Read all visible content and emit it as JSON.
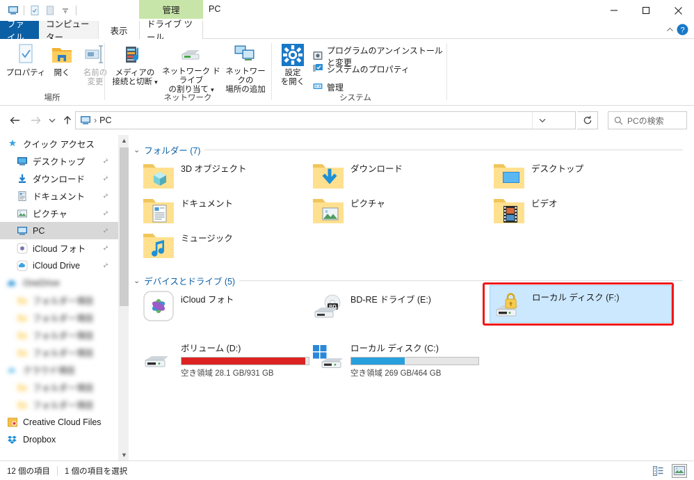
{
  "titlebar": {
    "quick_access": [
      "this-pc-icon",
      "properties-icon",
      "new-folder-icon",
      "customize-dropdown-icon"
    ],
    "contextual_tab_header": "管理",
    "window_title": "PC",
    "minimize": "minimize-icon",
    "maximize": "maximize-icon",
    "close": "close-icon"
  },
  "tabs": [
    {
      "label": "ファイル",
      "active": false
    },
    {
      "label": "コンピューター",
      "active": false
    },
    {
      "label": "表示",
      "active": false
    },
    {
      "label": "ドライブ ツール",
      "active": true
    }
  ],
  "ribbon": {
    "collapse_label": "collapse-ribbon-icon",
    "help_label": "help-icon",
    "groups": [
      {
        "name": "場所",
        "buttons": [
          {
            "label": "プロパティ",
            "icon": "properties-icon",
            "disabled": false
          },
          {
            "label": "開く",
            "icon": "open-folder-icon",
            "disabled": false
          },
          {
            "label": "名前の\n変更",
            "line1": "名前の",
            "line2": "変更",
            "icon": "rename-icon",
            "disabled": true
          }
        ]
      },
      {
        "name": "ネットワーク",
        "buttons": [
          {
            "line1": "メディアの",
            "line2": "接続と切断",
            "icon": "media-server-icon",
            "dropdown": true
          },
          {
            "line1": "ネットワーク ドライブ",
            "line2": "の割り当て",
            "icon": "map-network-drive-icon",
            "dropdown": true
          },
          {
            "line1": "ネットワークの",
            "line2": "場所の追加",
            "icon": "add-network-location-icon",
            "dropdown": false
          }
        ]
      },
      {
        "name": "システム",
        "buttons": [
          {
            "line1": "設定",
            "line2": "を開く",
            "icon": "settings-gear-icon"
          }
        ],
        "small_items": [
          {
            "label": "プログラムのアンインストールと変更",
            "icon": "uninstall-program-icon"
          },
          {
            "label": "システムのプロパティ",
            "icon": "system-properties-icon"
          },
          {
            "label": "管理",
            "icon": "manage-computer-icon"
          }
        ]
      }
    ]
  },
  "addressbar": {
    "back": "back-arrow-icon",
    "forward": "forward-arrow-icon",
    "recent": "recent-locations-icon",
    "up": "up-arrow-icon",
    "breadcrumb_icon": "this-pc-icon",
    "breadcrumbs": [
      "PC"
    ],
    "separator": "›",
    "dropdown": "address-dropdown-icon",
    "refresh": "refresh-icon",
    "search_placeholder": "PCの検索",
    "search_icon": "search-icon"
  },
  "navpane": {
    "items": [
      {
        "label": "クイック アクセス",
        "icon": "star-quick-access-icon",
        "indent": 8,
        "pinned": false,
        "selected": false,
        "blurred": false
      },
      {
        "label": "デスクトップ",
        "icon": "desktop-icon",
        "indent": 22,
        "pinned": true,
        "selected": false,
        "blurred": false
      },
      {
        "label": "ダウンロード",
        "icon": "downloads-icon",
        "indent": 22,
        "pinned": true,
        "selected": false,
        "blurred": false
      },
      {
        "label": "ドキュメント",
        "icon": "documents-icon",
        "indent": 22,
        "pinned": true,
        "selected": false,
        "blurred": false
      },
      {
        "label": "ピクチャ",
        "icon": "pictures-icon",
        "indent": 22,
        "pinned": true,
        "selected": false,
        "blurred": false
      },
      {
        "label": "PC",
        "icon": "this-pc-icon",
        "indent": 22,
        "pinned": true,
        "selected": true,
        "blurred": false
      },
      {
        "label": "iCloud フォト",
        "icon": "icloud-photos-icon",
        "indent": 22,
        "pinned": true,
        "selected": false,
        "blurred": false
      },
      {
        "label": "iCloud Drive",
        "icon": "icloud-drive-icon",
        "indent": 22,
        "pinned": true,
        "selected": false,
        "blurred": false
      },
      {
        "label": "OneDrive",
        "icon": "onedrive-icon",
        "indent": 8,
        "pinned": false,
        "selected": false,
        "blurred": true
      },
      {
        "label": "フォルダー項目",
        "icon": "folder-icon",
        "indent": 22,
        "pinned": false,
        "selected": false,
        "blurred": true
      },
      {
        "label": "フォルダー項目",
        "icon": "folder-icon",
        "indent": 22,
        "pinned": false,
        "selected": false,
        "blurred": true
      },
      {
        "label": "フォルダー項目",
        "icon": "folder-icon",
        "indent": 22,
        "pinned": false,
        "selected": false,
        "blurred": true
      },
      {
        "label": "フォルダー項目",
        "icon": "folder-icon",
        "indent": 22,
        "pinned": false,
        "selected": false,
        "blurred": true
      },
      {
        "label": "クラウド項目",
        "icon": "cloud-icon",
        "indent": 8,
        "pinned": false,
        "selected": false,
        "blurred": true
      },
      {
        "label": "フォルダー項目",
        "icon": "folder-icon",
        "indent": 22,
        "pinned": false,
        "selected": false,
        "blurred": true
      },
      {
        "label": "フォルダー項目",
        "icon": "folder-icon",
        "indent": 22,
        "pinned": false,
        "selected": false,
        "blurred": true
      },
      {
        "label": "Creative Cloud Files",
        "icon": "creative-cloud-icon",
        "indent": 8,
        "pinned": false,
        "selected": false,
        "blurred": false
      },
      {
        "label": "Dropbox",
        "icon": "dropbox-icon",
        "indent": 8,
        "pinned": false,
        "selected": false,
        "blurred": false
      }
    ]
  },
  "filepane": {
    "groups": [
      {
        "title": "フォルダー (7)",
        "expanded": true
      },
      {
        "title": "デバイスとドライブ (5)",
        "expanded": true
      }
    ],
    "folders": [
      {
        "name": "3D オブジェクト",
        "icon": "folder-3d-objects-icon",
        "col": 0,
        "row": 0
      },
      {
        "name": "ダウンロード",
        "icon": "folder-downloads-icon",
        "col": 1,
        "row": 0
      },
      {
        "name": "デスクトップ",
        "icon": "folder-desktop-icon",
        "col": 2,
        "row": 0
      },
      {
        "name": "ドキュメント",
        "icon": "folder-documents-icon",
        "col": 0,
        "row": 1
      },
      {
        "name": "ピクチャ",
        "icon": "folder-pictures-icon",
        "col": 1,
        "row": 1
      },
      {
        "name": "ビデオ",
        "icon": "folder-videos-icon",
        "col": 2,
        "row": 1
      },
      {
        "name": "ミュージック",
        "icon": "folder-music-icon",
        "col": 0,
        "row": 2
      }
    ],
    "drives": [
      {
        "name": "iCloud フォト",
        "icon": "icloud-photos-icon",
        "col": 0,
        "row": 0,
        "has_bar": false,
        "selected": false,
        "annotated": false
      },
      {
        "name": "BD-RE ドライブ (E:)",
        "icon": "bd-re-drive-icon",
        "col": 1,
        "row": 0,
        "has_bar": false,
        "selected": false,
        "annotated": false
      },
      {
        "name": "ローカル ディスク (F:)",
        "icon": "locked-drive-icon",
        "col": 2,
        "row": 0,
        "has_bar": false,
        "selected": true,
        "annotated": true
      },
      {
        "name": "ボリューム (D:)",
        "icon": "hard-drive-icon",
        "col": 0,
        "row": 1,
        "has_bar": true,
        "used_percent": 97,
        "bar_color": "#dd2222",
        "free_text": "空き領域 28.1 GB/931 GB",
        "selected": false,
        "annotated": false
      },
      {
        "name": "ローカル ディスク (C:)",
        "icon": "windows-drive-icon",
        "col": 1,
        "row": 1,
        "has_bar": true,
        "used_percent": 42,
        "bar_color": "#27a0dd",
        "free_text": "空き領域 269 GB/464 GB",
        "selected": false,
        "annotated": false
      }
    ]
  },
  "statusbar": {
    "item_count": "12 個の項目",
    "selection": "1 個の項目を選択",
    "views": [
      {
        "icon": "details-view-icon",
        "active": false
      },
      {
        "icon": "large-icons-view-icon",
        "active": true
      }
    ]
  },
  "colors": {
    "accent_blue": "#0b5fa4",
    "contextual_green": "#c7e5a8",
    "selection_blue": "#cce8ff",
    "annotation_red": "#f01717",
    "drive_full_red": "#dd2222",
    "drive_normal_blue": "#27a0dd"
  }
}
